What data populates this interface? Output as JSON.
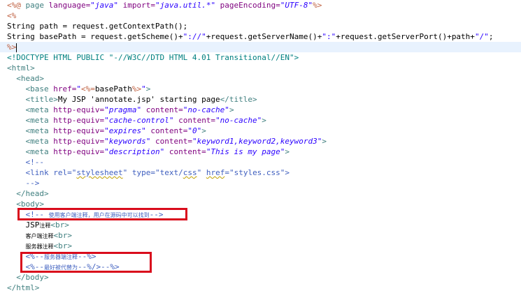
{
  "editor": {
    "lines": [
      {
        "indent": "",
        "tokens": [
          {
            "text": "<%@ ",
            "cls": "t-jsp"
          },
          {
            "text": "page ",
            "cls": "t-tag"
          },
          {
            "text": "language=",
            "cls": "t-attr"
          },
          {
            "text": "\"java\"",
            "cls": "t-val"
          },
          {
            "text": " import=",
            "cls": "t-attr"
          },
          {
            "text": "\"java.util.*\"",
            "cls": "t-val"
          },
          {
            "text": " pageEncoding=",
            "cls": "t-attr"
          },
          {
            "text": "\"UTF-8\"",
            "cls": "t-val"
          },
          {
            "text": "%>",
            "cls": "t-jsp"
          }
        ]
      },
      {
        "indent": "",
        "tokens": [
          {
            "text": "<%",
            "cls": "t-jsp"
          }
        ]
      },
      {
        "indent": "",
        "tokens": [
          {
            "text": "String path = request.getContextPath();",
            "cls": "t-plain"
          }
        ]
      },
      {
        "indent": "",
        "tokens": [
          {
            "text": "String basePath = request.getScheme()+",
            "cls": "t-plain"
          },
          {
            "text": "\"://\"",
            "cls": "t-str"
          },
          {
            "text": "+request.getServerName()+",
            "cls": "t-plain"
          },
          {
            "text": "\":\"",
            "cls": "t-str"
          },
          {
            "text": "+request.getServerPort()+path+",
            "cls": "t-plain"
          },
          {
            "text": "\"/\"",
            "cls": "t-str"
          },
          {
            "text": ";",
            "cls": "t-plain"
          }
        ]
      },
      {
        "indent": "",
        "highlighted": true,
        "tokens": [
          {
            "text": "%>",
            "cls": "t-jsp"
          }
        ]
      },
      {
        "indent": "",
        "tokens": [
          {
            "text": "<!DOCTYPE HTML PUBLIC \"-//W3C//DTD HTML 4.01 Transitional//EN\">",
            "cls": "t-doctype"
          }
        ]
      },
      {
        "indent": "",
        "tokens": [
          {
            "text": "<html>",
            "cls": "t-tag"
          }
        ]
      },
      {
        "indent": "  ",
        "tokens": [
          {
            "text": "<head>",
            "cls": "t-tag"
          }
        ]
      },
      {
        "indent": "    ",
        "tokens": [
          {
            "text": "<base ",
            "cls": "t-tag"
          },
          {
            "text": "href=",
            "cls": "t-attr"
          },
          {
            "text": "\"",
            "cls": "t-val"
          },
          {
            "text": "<%=",
            "cls": "t-jsp"
          },
          {
            "text": "basePath",
            "cls": "t-plain"
          },
          {
            "text": "%>",
            "cls": "t-jsp"
          },
          {
            "text": "\"",
            "cls": "t-val"
          },
          {
            "text": ">",
            "cls": "t-tag"
          }
        ]
      },
      {
        "indent": "    ",
        "tokens": [
          {
            "text": "<title>",
            "cls": "t-tag"
          },
          {
            "text": "My JSP 'annotate.jsp' starting page",
            "cls": "t-text"
          },
          {
            "text": "</title>",
            "cls": "t-tag"
          }
        ]
      },
      {
        "indent": "    ",
        "tokens": [
          {
            "text": "<meta ",
            "cls": "t-tag"
          },
          {
            "text": "http-equiv=",
            "cls": "t-attr"
          },
          {
            "text": "\"pragma\"",
            "cls": "t-val"
          },
          {
            "text": " content=",
            "cls": "t-attr"
          },
          {
            "text": "\"no-cache\"",
            "cls": "t-val"
          },
          {
            "text": ">",
            "cls": "t-tag"
          }
        ]
      },
      {
        "indent": "    ",
        "tokens": [
          {
            "text": "<meta ",
            "cls": "t-tag"
          },
          {
            "text": "http-equiv=",
            "cls": "t-attr"
          },
          {
            "text": "\"cache-control\"",
            "cls": "t-val"
          },
          {
            "text": " content=",
            "cls": "t-attr"
          },
          {
            "text": "\"no-cache\"",
            "cls": "t-val"
          },
          {
            "text": ">",
            "cls": "t-tag"
          }
        ]
      },
      {
        "indent": "    ",
        "tokens": [
          {
            "text": "<meta ",
            "cls": "t-tag"
          },
          {
            "text": "http-equiv=",
            "cls": "t-attr"
          },
          {
            "text": "\"expires\"",
            "cls": "t-val"
          },
          {
            "text": " content=",
            "cls": "t-attr"
          },
          {
            "text": "\"0\"",
            "cls": "t-val"
          },
          {
            "text": ">",
            "cls": "t-tag"
          }
        ]
      },
      {
        "indent": "    ",
        "tokens": [
          {
            "text": "<meta ",
            "cls": "t-tag"
          },
          {
            "text": "http-equiv=",
            "cls": "t-attr"
          },
          {
            "text": "\"keywords\"",
            "cls": "t-val"
          },
          {
            "text": " content=",
            "cls": "t-attr"
          },
          {
            "text": "\"keyword1,keyword2,keyword3\"",
            "cls": "t-val"
          },
          {
            "text": ">",
            "cls": "t-tag"
          }
        ]
      },
      {
        "indent": "    ",
        "tokens": [
          {
            "text": "<meta ",
            "cls": "t-tag"
          },
          {
            "text": "http-equiv=",
            "cls": "t-attr"
          },
          {
            "text": "\"description\"",
            "cls": "t-val"
          },
          {
            "text": " content=",
            "cls": "t-attr"
          },
          {
            "text": "\"This is my page\"",
            "cls": "t-val"
          },
          {
            "text": ">",
            "cls": "t-tag"
          }
        ]
      },
      {
        "indent": "    ",
        "tokens": [
          {
            "text": "<!--",
            "cls": "t-comment"
          }
        ]
      },
      {
        "indent": "    ",
        "tokens": [
          {
            "text": "<link ",
            "cls": "t-comment"
          },
          {
            "text": "rel",
            "cls": "t-comment"
          },
          {
            "text": "=\"",
            "cls": "t-comment"
          },
          {
            "text": "stylesheet",
            "cls": "t-comment ul"
          },
          {
            "text": "\" type=\"text/",
            "cls": "t-comment"
          },
          {
            "text": "css",
            "cls": "t-comment ul"
          },
          {
            "text": "\" ",
            "cls": "t-comment"
          },
          {
            "text": "href",
            "cls": "t-comment ul"
          },
          {
            "text": "=\"styles.css\">",
            "cls": "t-comment"
          }
        ]
      },
      {
        "indent": "    ",
        "tokens": [
          {
            "text": "-->",
            "cls": "t-comment"
          }
        ]
      },
      {
        "indent": "  ",
        "tokens": [
          {
            "text": "</head>",
            "cls": "t-tag"
          }
        ]
      },
      {
        "indent": "  ",
        "tokens": [
          {
            "text": "<body>",
            "cls": "t-tag"
          }
        ]
      },
      {
        "indent": "    ",
        "tokens": [
          {
            "text": "<!-- ",
            "cls": "t-comment"
          },
          {
            "text": "使用客户端注释，用户在源码中可以找到",
            "cls": "t-comment cjk"
          },
          {
            "text": "-->",
            "cls": "t-comment"
          }
        ]
      },
      {
        "indent": "    ",
        "tokens": [
          {
            "text": "JSP",
            "cls": "t-text"
          },
          {
            "text": "注释",
            "cls": "t-text cjk"
          },
          {
            "text": "<br>",
            "cls": "t-tag"
          }
        ]
      },
      {
        "indent": "    ",
        "tokens": [
          {
            "text": "客户端注释",
            "cls": "t-text cjk"
          },
          {
            "text": "<br>",
            "cls": "t-tag"
          }
        ]
      },
      {
        "indent": "    ",
        "tokens": [
          {
            "text": "服务器注释",
            "cls": "t-text cjk"
          },
          {
            "text": "<br>",
            "cls": "t-tag"
          }
        ]
      },
      {
        "indent": "    ",
        "tokens": [
          {
            "text": "<%--",
            "cls": "t-comment"
          },
          {
            "text": "服务器端注释",
            "cls": "t-comment cjk"
          },
          {
            "text": "--%>",
            "cls": "t-comment"
          }
        ]
      },
      {
        "indent": "    ",
        "tokens": [
          {
            "text": "<%--",
            "cls": "t-comment"
          },
          {
            "text": "最好被代替为",
            "cls": "t-comment cjk"
          },
          {
            "text": "--%/>--%>",
            "cls": "t-comment"
          }
        ]
      },
      {
        "indent": "  ",
        "tokens": [
          {
            "text": "</body>",
            "cls": "t-tag"
          }
        ]
      },
      {
        "indent": "",
        "tokens": [
          {
            "text": "</html>",
            "cls": "t-tag"
          }
        ]
      }
    ]
  },
  "annotations": {
    "color": "#d90c1c",
    "boxes": [
      {
        "name": "client-comment-highlight"
      },
      {
        "name": "server-comment-highlight"
      }
    ]
  }
}
